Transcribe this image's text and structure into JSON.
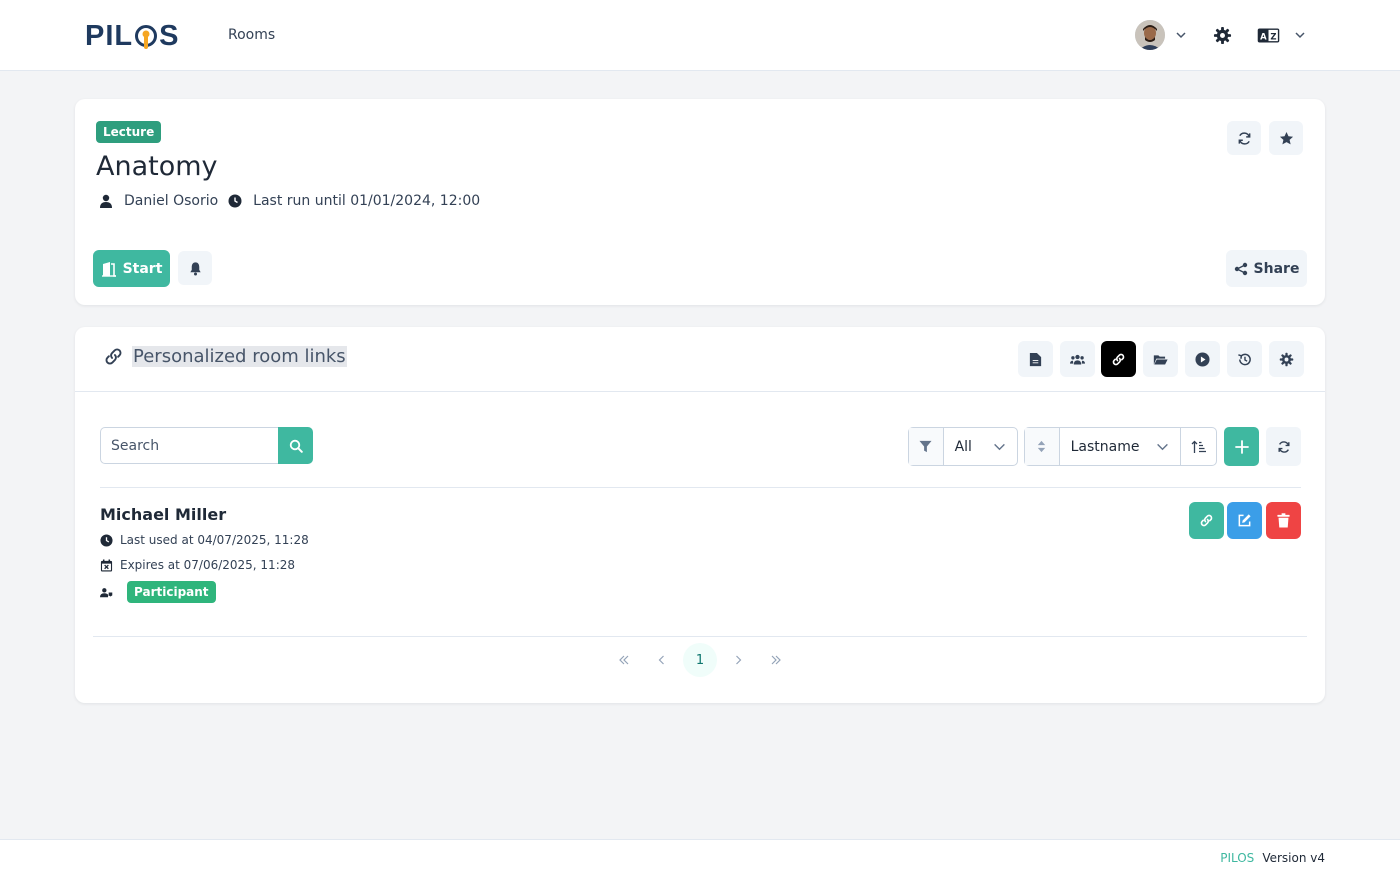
{
  "navbar": {
    "logo_text_left": "PIL",
    "logo_text_right": "S",
    "rooms_link": "Rooms"
  },
  "room": {
    "type_tag": "Lecture",
    "title": "Anatomy",
    "owner": "Daniel Osorio",
    "last_run": "Last run until 01/01/2024, 12:00",
    "start_label": "Start",
    "share_label": "Share"
  },
  "links": {
    "title": "Personalized room links",
    "search_placeholder": "Search",
    "filter_value": "All",
    "sort_value": "Lastname",
    "items": [
      {
        "name": "Michael Miller",
        "last_used": "Last used at 04/07/2025, 11:28",
        "expires": "Expires at 07/06/2025, 11:28",
        "role": "Participant"
      }
    ],
    "pagination": {
      "current_page": "1"
    }
  },
  "footer": {
    "brand": "PILOS",
    "version": "Version v4"
  },
  "colors": {
    "accent_teal": "#3fb8a0",
    "lecture_tag": "#2e9e7e",
    "participant_badge": "#2fb57c",
    "edit_blue": "#3b9ee8",
    "delete_red": "#ef4444",
    "active_tab": "#000000"
  },
  "icons": {
    "nav": [
      "avatar",
      "chevron-down-icon",
      "gear-icon",
      "language-icon",
      "chevron-down-icon"
    ],
    "room_actions": [
      "refresh-icon",
      "star-icon",
      "bell-icon",
      "share-icon",
      "door-icon"
    ],
    "tabs": [
      "file-icon",
      "users-icon",
      "link-icon",
      "folder-icon",
      "play-icon",
      "history-icon",
      "gear-icon"
    ],
    "row_actions": [
      "link-icon",
      "edit-icon",
      "trash-icon"
    ]
  }
}
